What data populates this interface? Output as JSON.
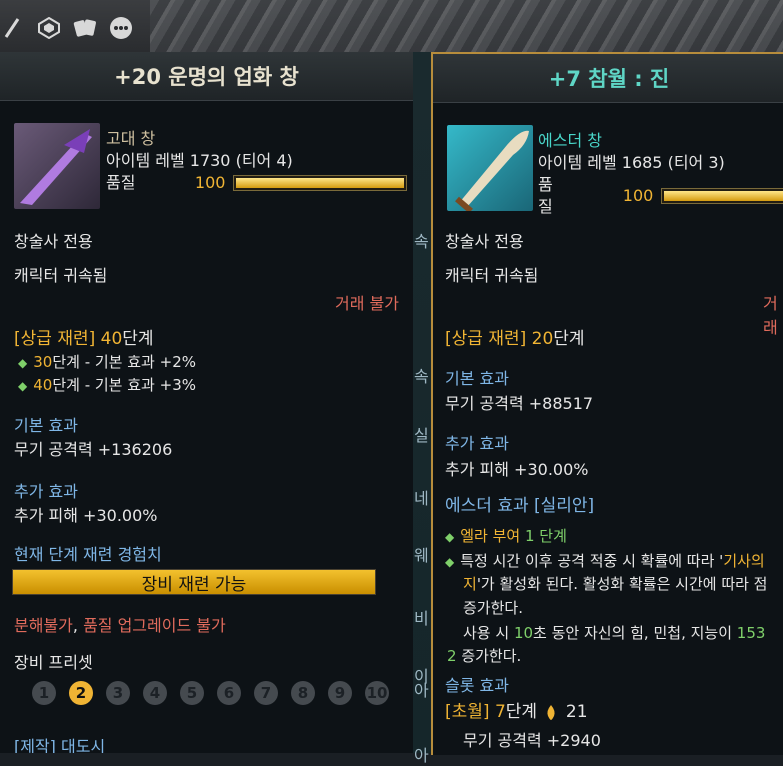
{
  "left": {
    "title": "+20 운명의 업화 창",
    "rarity": "고대 창",
    "item_level": "아이템 레벨 1730 (티어 4)",
    "quality_label": "품질",
    "quality_value": "100",
    "quality": 100,
    "class_only": "창술사 전용",
    "bound": "캐릭터 귀속됨",
    "trade": "거래 불가",
    "advanced_refine_tag": "[상급 재련]",
    "advanced_refine_stage": "40",
    "advanced_refine_unit": "단계",
    "bonus": [
      {
        "stage": "30",
        "unit": "단계",
        "text": " - 기본 효과 +2%"
      },
      {
        "stage": "40",
        "unit": "단계",
        "text": " - 기본 효과 +3%"
      }
    ],
    "base_effect_label": "기본 효과",
    "base_effect": "무기 공격력 +136206",
    "extra_effect_label": "추가 효과",
    "extra_effect": "추가 피해 +30.00%",
    "refine_exp_label": "현재 단계 재련 경험치",
    "refine_bar_text": "장비 재련 가능",
    "warnings": {
      "a": "분해불가",
      "sep": ", ",
      "b": "품질 업그레이드 불가"
    },
    "preset_label": "장비 프리셋",
    "presets": [
      "1",
      "2",
      "3",
      "4",
      "5",
      "6",
      "7",
      "8",
      "9",
      "10"
    ],
    "active_preset": "2",
    "crafted": "[제작] 대도시"
  },
  "right": {
    "title": "+7 참월 : 진",
    "rarity": "에스더 창",
    "item_level": "아이템 레벨 1685 (티어 3)",
    "quality_label": "품질",
    "quality_value": "100",
    "quality": 100,
    "class_only": "창술사 전용",
    "bound": "캐릭터 귀속됨",
    "trade": "거래",
    "advanced_refine_tag": "[상급 재련]",
    "advanced_refine_stage": "20",
    "advanced_refine_unit": "단계",
    "base_effect_label": "기본 효과",
    "base_effect": "무기 공격력 +88517",
    "extra_effect_label": "추가 효과",
    "extra_effect": "추가 피해 +30.00%",
    "esther_effect_label": "에스더 효과 [실리안]",
    "ella_a": "엘라 부여 ",
    "ella_b": "1 단계",
    "skill_line1a": "특정 시간 이후 공격 적중 시 확률에 따라 '",
    "skill_line1b": "기사의",
    "skill_line2a": "지",
    "skill_line2b": "'가 활성화 된다. 활성화 확률은 시간에 따라 점",
    "skill_line3": "증가한다.",
    "skill_line4a": "사용 시 ",
    "skill_line4b": "10",
    "skill_line4c": "초 동안 자신의 힘, 민첩, 지능이 ",
    "skill_line4d": "153",
    "skill_line5a": "2",
    "skill_line5b": " 증가한다.",
    "soul_label": "슬롯 효과",
    "transcend_tag": "[초월]",
    "transcend_stage": "7",
    "transcend_unit": "단계",
    "transcend_count": "21",
    "transcend_effect": "무기 공격력 +2940"
  },
  "gap_chars": [
    "속",
    "속",
    "실",
    "네",
    "웨",
    "비",
    "이",
    "아",
    "아"
  ],
  "colors": {
    "accent": "#f0b434",
    "esther": "#49d6c9",
    "border_right": "#b78d3c"
  }
}
